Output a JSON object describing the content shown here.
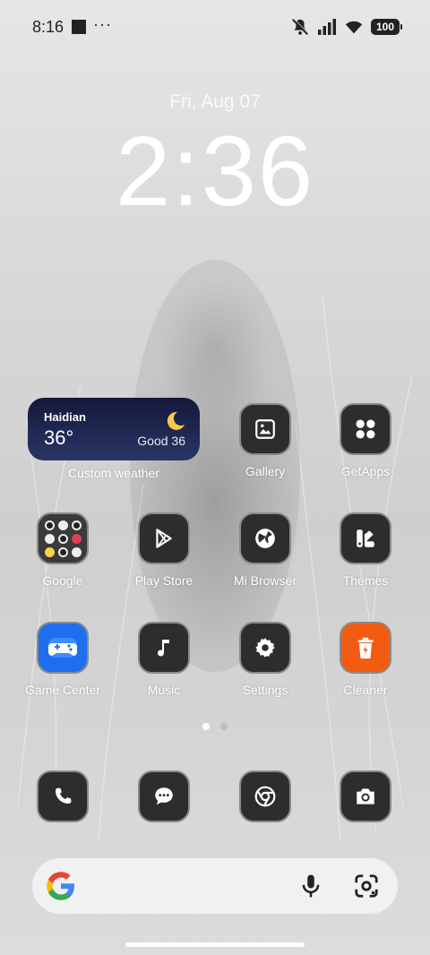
{
  "status_bar": {
    "time": "8:16",
    "more": "···",
    "battery": "100"
  },
  "clock": {
    "date": "Fri, Aug 07",
    "time": "2:36"
  },
  "weather_widget": {
    "city": "Haidian",
    "temperature": "36°",
    "air_quality": "Good 36",
    "label": "Custom weather"
  },
  "apps": {
    "gallery": "Gallery",
    "getapps": "GetApps",
    "google": "Google",
    "play_store": "Play Store",
    "mi_browser": "Mi Browser",
    "themes": "Themes",
    "game_center": "Game Center",
    "music": "Music",
    "settings": "Settings",
    "cleaner": "Cleaner"
  },
  "pages": {
    "count": 2,
    "active": 1
  },
  "colors": {
    "weather_bg": "#14193a",
    "icon_bg": "#2d2d2d",
    "game_center": "#1e6ff0",
    "cleaner": "#f25c12"
  }
}
